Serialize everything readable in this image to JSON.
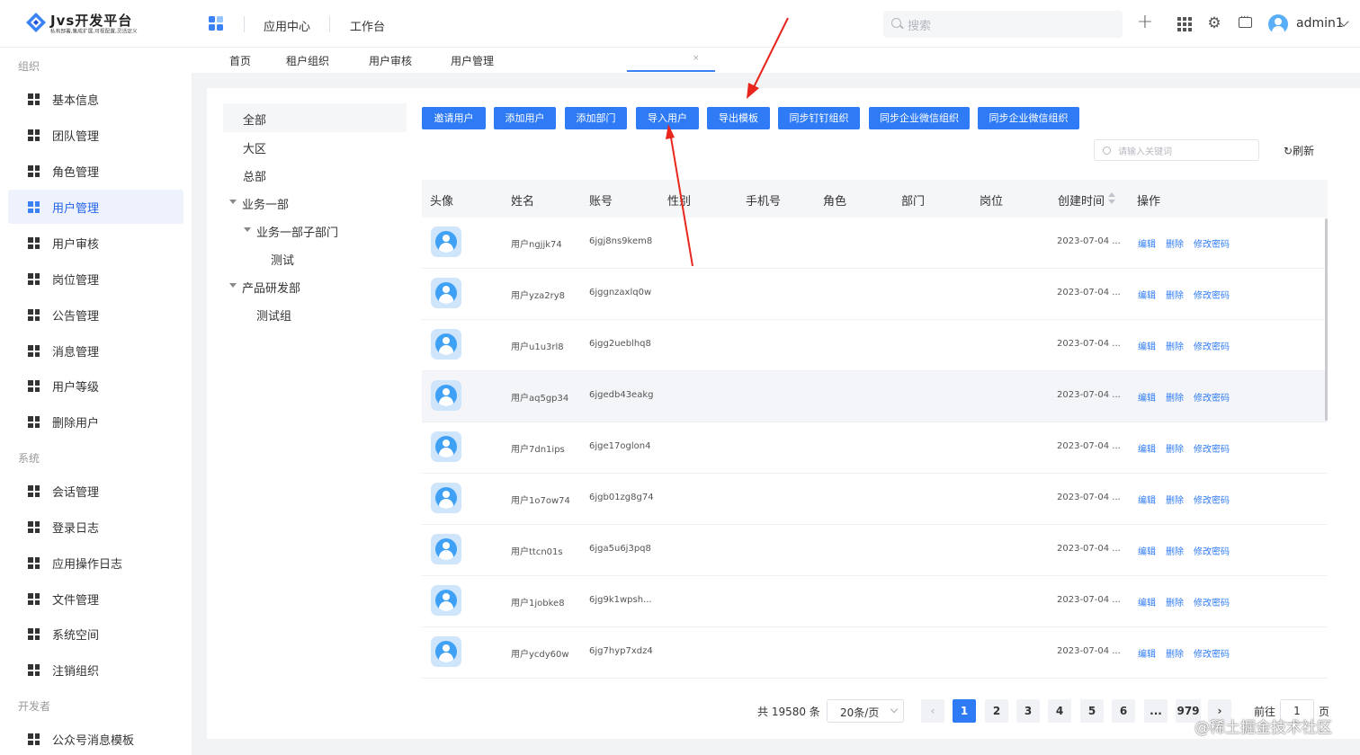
{
  "header": {
    "logo_title": "Jvs开发平台",
    "logo_subtitle": "私有部署,集成扩展,可视配置,灵活定义",
    "nav": [
      "应用中心",
      "工作台"
    ],
    "search_placeholder": "搜索",
    "user_name": "admin1",
    "icons": [
      "apps-icon",
      "plus-icon",
      "grid-icon",
      "gear-icon",
      "message-icon",
      "avatar"
    ]
  },
  "sidebar": {
    "groups": [
      {
        "label": "组织",
        "items": [
          "基本信息",
          "团队管理",
          "角色管理",
          "用户管理",
          "用户审核",
          "岗位管理",
          "公告管理",
          "消息管理",
          "用户等级",
          "删除用户"
        ]
      },
      {
        "label": "系统",
        "items": [
          "会话管理",
          "登录日志",
          "应用操作日志",
          "文件管理",
          "系统空间",
          "注销组织"
        ]
      },
      {
        "label": "开发者",
        "items": [
          "公众号消息模板"
        ]
      }
    ],
    "active_item": "用户管理"
  },
  "tabs": [
    {
      "label": "首页"
    },
    {
      "label": "租户组织"
    },
    {
      "label": "用户审核"
    },
    {
      "label": "用户管理",
      "active": true,
      "close": "×"
    }
  ],
  "tree": [
    {
      "label": "全部",
      "level": 0,
      "selected": true
    },
    {
      "label": "大区",
      "level": 0
    },
    {
      "label": "总部",
      "level": 0
    },
    {
      "label": "业务一部",
      "level": 0,
      "expanded": true
    },
    {
      "label": "业务一部子部门",
      "level": 1,
      "expanded": true
    },
    {
      "label": "测试",
      "level": 2
    },
    {
      "label": "产品研发部",
      "level": 0,
      "expanded": true
    },
    {
      "label": "测试组",
      "level": 1
    }
  ],
  "toolbar": {
    "buttons": [
      "邀请用户",
      "添加用户",
      "添加部门",
      "导入用户",
      "导出模板",
      "同步钉钉组织",
      "同步企业微信组织",
      "同步企业微信组织"
    ],
    "keyword_placeholder": "请输入关键词",
    "refresh_label": "刷新"
  },
  "table": {
    "columns": [
      "头像",
      "姓名",
      "账号",
      "性别",
      "手机号",
      "角色",
      "部门",
      "岗位",
      "创建时间",
      "操作"
    ],
    "rows": [
      {
        "name": "用户ngjjk74",
        "account": "6jgj8ns9kem8",
        "created": "2023-07-04 ..."
      },
      {
        "name": "用户yza2ry8",
        "account": "6jggnzaxlq0w",
        "created": "2023-07-04 ..."
      },
      {
        "name": "用户u1u3rl8",
        "account": "6jgg2ueblhq8",
        "created": "2023-07-04 ..."
      },
      {
        "name": "用户aq5gp34",
        "account": "6jgedb43eakg",
        "created": "2023-07-04 ...",
        "highlight": true
      },
      {
        "name": "用户7dn1ips",
        "account": "6jge17oglon4",
        "created": "2023-07-04 ..."
      },
      {
        "name": "用户1o7ow74",
        "account": "6jgb01zg8g74",
        "created": "2023-07-04 ..."
      },
      {
        "name": "用户ttcn01s",
        "account": "6jga5u6j3pq8",
        "created": "2023-07-04 ..."
      },
      {
        "name": "用户1jobke8",
        "account": "6jg9k1wpsh...",
        "created": "2023-07-04 ..."
      },
      {
        "name": "用户ycdy60w",
        "account": "6jg7hyp7xdz4",
        "created": "2023-07-04 ..."
      }
    ],
    "actions": [
      "编辑",
      "删除",
      "修改密码"
    ]
  },
  "pagination": {
    "total_text": "共 19580 条",
    "page_size": "20条/页",
    "pages": [
      "1",
      "2",
      "3",
      "4",
      "5",
      "6",
      "...",
      "979"
    ],
    "current": "1",
    "goto_prefix": "前往",
    "goto_value": "1",
    "goto_suffix": "页",
    "prev": "‹",
    "next": "›"
  },
  "watermark": "@稀土掘金技术社区",
  "colors": {
    "accent": "#2f7bf5",
    "annotation_arrow": "#e8261d",
    "avatar": "#3ea1f6"
  }
}
